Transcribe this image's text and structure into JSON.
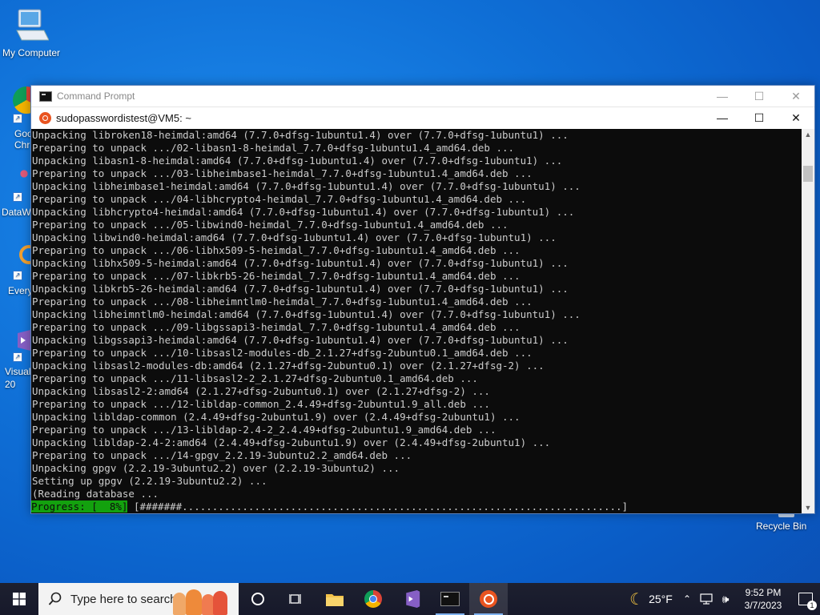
{
  "desktop": {
    "icons": [
      {
        "label": "My Computer"
      },
      {
        "label": "Goo\nChr"
      },
      {
        "label": "DataW"
      },
      {
        "label": "Every"
      },
      {
        "label": "Visual\n20"
      }
    ],
    "recycle_bin": "Recycle Bin"
  },
  "outer_window": {
    "title": "Command Prompt"
  },
  "inner_window": {
    "title": "sudopasswordistest@VM5: ~"
  },
  "terminal": {
    "lines": [
      "Unpacking libroken18-heimdal:amd64 (7.7.0+dfsg-1ubuntu1.4) over (7.7.0+dfsg-1ubuntu1) ...",
      "Preparing to unpack .../02-libasn1-8-heimdal_7.7.0+dfsg-1ubuntu1.4_amd64.deb ...",
      "Unpacking libasn1-8-heimdal:amd64 (7.7.0+dfsg-1ubuntu1.4) over (7.7.0+dfsg-1ubuntu1) ...",
      "Preparing to unpack .../03-libheimbase1-heimdal_7.7.0+dfsg-1ubuntu1.4_amd64.deb ...",
      "Unpacking libheimbase1-heimdal:amd64 (7.7.0+dfsg-1ubuntu1.4) over (7.7.0+dfsg-1ubuntu1) ...",
      "Preparing to unpack .../04-libhcrypto4-heimdal_7.7.0+dfsg-1ubuntu1.4_amd64.deb ...",
      "Unpacking libhcrypto4-heimdal:amd64 (7.7.0+dfsg-1ubuntu1.4) over (7.7.0+dfsg-1ubuntu1) ...",
      "Preparing to unpack .../05-libwind0-heimdal_7.7.0+dfsg-1ubuntu1.4_amd64.deb ...",
      "Unpacking libwind0-heimdal:amd64 (7.7.0+dfsg-1ubuntu1.4) over (7.7.0+dfsg-1ubuntu1) ...",
      "Preparing to unpack .../06-libhx509-5-heimdal_7.7.0+dfsg-1ubuntu1.4_amd64.deb ...",
      "Unpacking libhx509-5-heimdal:amd64 (7.7.0+dfsg-1ubuntu1.4) over (7.7.0+dfsg-1ubuntu1) ...",
      "Preparing to unpack .../07-libkrb5-26-heimdal_7.7.0+dfsg-1ubuntu1.4_amd64.deb ...",
      "Unpacking libkrb5-26-heimdal:amd64 (7.7.0+dfsg-1ubuntu1.4) over (7.7.0+dfsg-1ubuntu1) ...",
      "Preparing to unpack .../08-libheimntlm0-heimdal_7.7.0+dfsg-1ubuntu1.4_amd64.deb ...",
      "Unpacking libheimntlm0-heimdal:amd64 (7.7.0+dfsg-1ubuntu1.4) over (7.7.0+dfsg-1ubuntu1) ...",
      "Preparing to unpack .../09-libgssapi3-heimdal_7.7.0+dfsg-1ubuntu1.4_amd64.deb ...",
      "Unpacking libgssapi3-heimdal:amd64 (7.7.0+dfsg-1ubuntu1.4) over (7.7.0+dfsg-1ubuntu1) ...",
      "Preparing to unpack .../10-libsasl2-modules-db_2.1.27+dfsg-2ubuntu0.1_amd64.deb ...",
      "Unpacking libsasl2-modules-db:amd64 (2.1.27+dfsg-2ubuntu0.1) over (2.1.27+dfsg-2) ...",
      "Preparing to unpack .../11-libsasl2-2_2.1.27+dfsg-2ubuntu0.1_amd64.deb ...",
      "Unpacking libsasl2-2:amd64 (2.1.27+dfsg-2ubuntu0.1) over (2.1.27+dfsg-2) ...",
      "Preparing to unpack .../12-libldap-common_2.4.49+dfsg-2ubuntu1.9_all.deb ...",
      "Unpacking libldap-common (2.4.49+dfsg-2ubuntu1.9) over (2.4.49+dfsg-2ubuntu1) ...",
      "Preparing to unpack .../13-libldap-2.4-2_2.4.49+dfsg-2ubuntu1.9_amd64.deb ...",
      "Unpacking libldap-2.4-2:amd64 (2.4.49+dfsg-2ubuntu1.9) over (2.4.49+dfsg-2ubuntu1) ...",
      "Preparing to unpack .../14-gpgv_2.2.19-3ubuntu2.2_amd64.deb ...",
      "Unpacking gpgv (2.2.19-3ubuntu2.2) over (2.2.19-3ubuntu2) ...",
      "Setting up gpgv (2.2.19-3ubuntu2.2) ...",
      "(Reading database ..."
    ],
    "progress_label": "Progress: [  8%]",
    "progress_bar": " [#######.........................................................................]",
    "progress_percent": 8
  },
  "taskbar": {
    "search_placeholder": "Type here to search",
    "weather": "25°F",
    "time": "9:52 PM",
    "date": "3/7/2023",
    "notification_count": "1",
    "apps": [
      "task-view",
      "file-explorer",
      "chrome",
      "visual-studio",
      "command-prompt",
      "ubuntu"
    ]
  }
}
